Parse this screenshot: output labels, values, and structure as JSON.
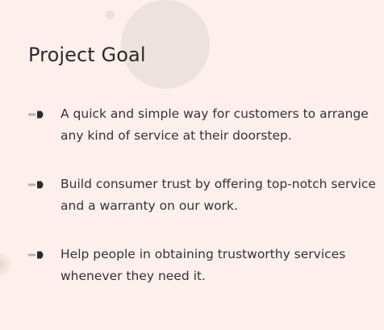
{
  "section": {
    "title": "Project Goal"
  },
  "goals": [
    {
      "icon": "arrow-bullet-icon",
      "text": "A quick and simple way for customers to arrange any kind of service at their doorstep."
    },
    {
      "icon": "arrow-bullet-icon",
      "text": "Build consumer trust by offering top-notch service and a warranty on our work."
    },
    {
      "icon": "arrow-bullet-icon",
      "text": "Help people in obtaining trustworthy services whenever they need it."
    }
  ],
  "colors": {
    "background": "#fdf0ec",
    "decorative_circle": "#eee2de",
    "text": "#2b2b2b",
    "bullet_dark": "#2b2b2b",
    "bullet_light": "#b0b0b0"
  }
}
